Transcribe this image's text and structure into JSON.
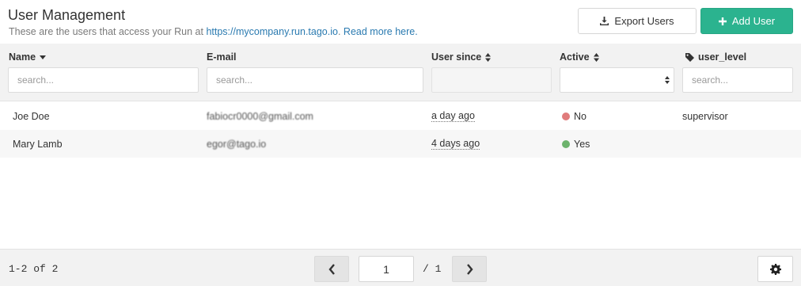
{
  "header": {
    "title": "User Management",
    "subtitle_prefix": "These are the users that access your Run at ",
    "run_url": "https://mycompany.run.tago.io",
    "subtitle_sep": ". ",
    "read_more": "Read more here.",
    "export_label": "Export Users",
    "add_label": "Add User",
    "export_icon": "download-icon",
    "add_icon": "plus-icon"
  },
  "columns": {
    "name": {
      "label": "Name",
      "sort_icon": "caret-down-icon",
      "placeholder": "search..."
    },
    "email": {
      "label": "E-mail",
      "placeholder": "search..."
    },
    "user_since": {
      "label": "User since",
      "sort_icon": "sort-icon"
    },
    "active": {
      "label": "Active",
      "sort_icon": "sort-icon",
      "selected": ""
    },
    "user_level": {
      "label": "user_level",
      "tag_icon": "tag-icon",
      "placeholder": "search..."
    }
  },
  "rows": [
    {
      "name": "Joe Doe",
      "email": "fabiocr0000@gmail.com",
      "user_since": "a day ago",
      "active": "No",
      "active_color": "#e07b7b",
      "user_level": "supervisor"
    },
    {
      "name": "Mary Lamb",
      "email": "egor@tago.io",
      "user_since": "4 days ago",
      "active": "Yes",
      "active_color": "#6db36d",
      "user_level": ""
    }
  ],
  "footer": {
    "count": "1-2 of 2",
    "page_value": "1",
    "page_total": "/ 1",
    "prev_icon": "chevron-left-icon",
    "next_icon": "chevron-right-icon",
    "settings_icon": "gear-icon"
  },
  "colors": {
    "accent": "#2bb38f",
    "link": "#2a7ab0",
    "inactive": "#e07b7b",
    "active": "#6db36d"
  }
}
